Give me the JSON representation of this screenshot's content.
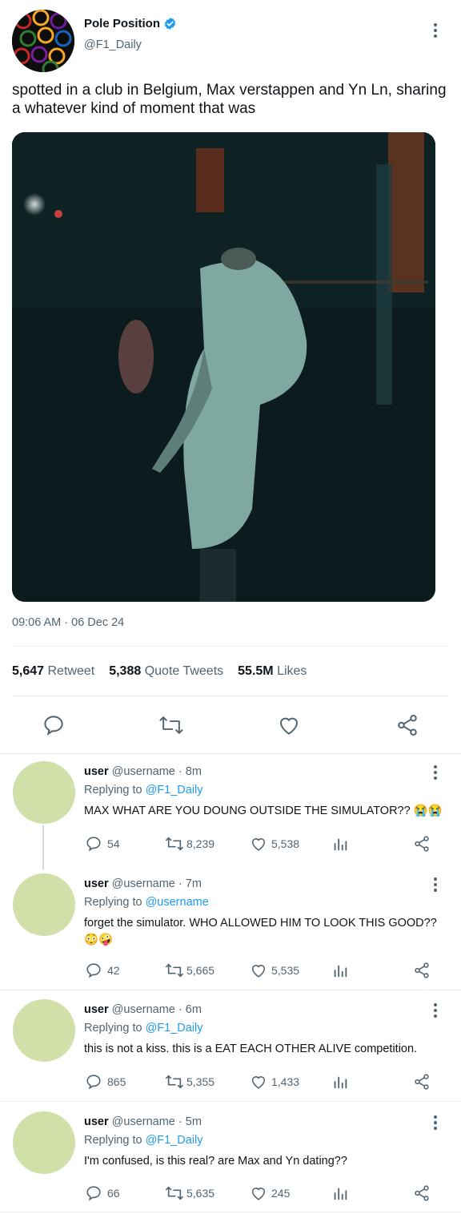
{
  "tweet": {
    "display_name": "Pole Position",
    "handle": "@F1_Daily",
    "verified": true,
    "text": "spotted in a club in Belgium, Max verstappen and Yn Ln, sharing a whatever kind of moment that was",
    "timestamp": "09:06 AM · 06 Dec 24",
    "stats": {
      "retweets_value": "5,647",
      "retweets_label": "Retweet",
      "quotes_value": "5,388",
      "quotes_label": "Quote Tweets",
      "likes_value": "55.5M",
      "likes_label": "Likes"
    }
  },
  "replies": [
    {
      "name": "user",
      "meta": "@username · 8m",
      "replying_prefix": "Replying to ",
      "replying_to": "@F1_Daily",
      "text": "MAX WHAT ARE YOU DOUNG OUTSIDE THE SIMULATOR?? 😭😭",
      "comments": "54",
      "retweets": "8,239",
      "likes": "5,538"
    },
    {
      "name": "user",
      "meta": "@username · 7m",
      "replying_prefix": "Replying to ",
      "replying_to": "@username",
      "text": "forget the simulator. WHO ALLOWED HIM TO LOOK THIS GOOD?? 😳🤪",
      "comments": "42",
      "retweets": "5,665",
      "likes": "5,535"
    },
    {
      "name": "user",
      "meta": "@username · 6m",
      "replying_prefix": "Replying to ",
      "replying_to": "@F1_Daily",
      "text": "this is not a kiss. this is a EAT EACH OTHER ALIVE competition.",
      "comments": "865",
      "retweets": "5,355",
      "likes": "1,433"
    },
    {
      "name": "user",
      "meta": "@username · 5m",
      "replying_prefix": "Replying to ",
      "replying_to": "@F1_Daily",
      "text": "I'm confused, is this real? are Max and Yn dating??",
      "comments": "66",
      "retweets": "5,635",
      "likes": "245"
    }
  ],
  "colors": {
    "accent": "#1d9bf0",
    "muted": "#536471",
    "avatar_placeholder": "#d1dfa9",
    "divider": "#e6ecf0"
  },
  "icons": {
    "verified": "verified-badge-icon",
    "more": "more-vertical-icon",
    "reply": "reply-bubble-icon",
    "retweet": "retweet-icon",
    "like": "heart-icon",
    "share": "share-icon",
    "analytics": "analytics-bars-icon"
  }
}
